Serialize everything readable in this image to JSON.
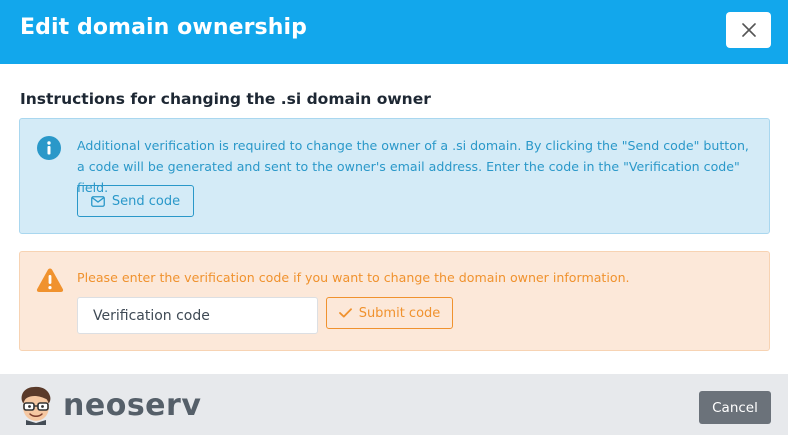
{
  "header": {
    "title": "Edit domain ownership",
    "close_icon": "close-icon"
  },
  "section": {
    "title": "Instructions for changing the .si domain owner"
  },
  "info": {
    "icon": "info-circle-icon",
    "text": "Additional verification is required to change the owner of a .si domain. By clicking the \"Send code\" button, a code will be generated and sent to the owner's email address. Enter the code in the \"Verification code\" field.",
    "send_button": {
      "icon": "envelope-icon",
      "label": "Send code"
    }
  },
  "warning": {
    "icon": "warning-triangle-icon",
    "text": "Please enter the verification code if you want to change the domain owner information.",
    "input": {
      "value": "",
      "placeholder": "Verification code"
    },
    "submit_button": {
      "icon": "check-icon",
      "label": "Submit code"
    }
  },
  "footer": {
    "logo_text": "neoserv",
    "logo_icon": "mascot-logo-icon",
    "cancel_label": "Cancel"
  },
  "colors": {
    "header_bg": "#12a7ec",
    "info_bg": "#d4ebf7",
    "info_accent": "#2a98c9",
    "warning_bg": "#fce8d9",
    "warning_accent": "#f0922e",
    "footer_bg": "#e7e9ec",
    "cancel_bg": "#6b727a"
  }
}
